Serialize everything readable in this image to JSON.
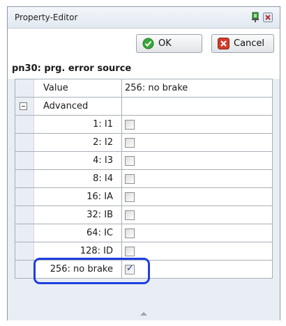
{
  "window": {
    "title": "Property-Editor"
  },
  "toolbar": {
    "ok_label": "OK",
    "cancel_label": "Cancel"
  },
  "parameter": {
    "heading": "pn30: prg. error source"
  },
  "grid": {
    "value_row": {
      "name": "Value",
      "value": "256: no brake"
    },
    "group_row": {
      "name": "Advanced"
    },
    "bits": [
      {
        "name": "1: I1",
        "checked": false
      },
      {
        "name": "2: I2",
        "checked": false
      },
      {
        "name": "4: I3",
        "checked": false
      },
      {
        "name": "8: I4",
        "checked": false
      },
      {
        "name": "16: IA",
        "checked": false
      },
      {
        "name": "32: IB",
        "checked": false
      },
      {
        "name": "64: IC",
        "checked": false
      },
      {
        "name": "128: ID",
        "checked": false
      },
      {
        "name": "256: no brake",
        "checked": true
      }
    ]
  },
  "icons": {
    "title_pin": "pin-icon",
    "title_close": "close-icon",
    "ok": "check-circle-icon",
    "cancel": "cancel-x-icon"
  },
  "colors": {
    "highlight": "#1f3ee0",
    "ok_green": "#3aa63a",
    "cancel_red": "#d23c2a"
  }
}
